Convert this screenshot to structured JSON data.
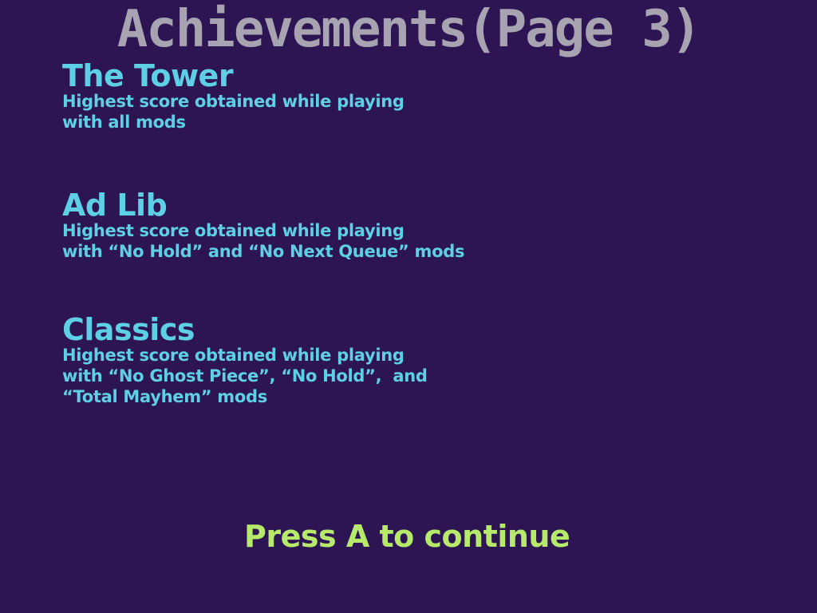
{
  "screen": {
    "title": "Achievements(Page 3)",
    "continue_prompt": "Press A to continue"
  },
  "achievements": [
    {
      "name": "The Tower",
      "desc_lines": [
        "Highest score obtained while playing",
        "with all mods"
      ]
    },
    {
      "name": "Ad Lib",
      "desc_lines": [
        "Highest score obtained while playing",
        "with “No Hold” and “No Next Queue” mods"
      ]
    },
    {
      "name": "Classics",
      "desc_lines": [
        "Highest score obtained while playing",
        "with “No Ghost Piece”, “No Hold”,  and",
        "“Total Mayhem” mods"
      ]
    }
  ],
  "colors": {
    "background": "#2d1452",
    "title": "#a7a3b0",
    "achievement_text": "#5ed0e6",
    "prompt": "#b7ea6a"
  }
}
